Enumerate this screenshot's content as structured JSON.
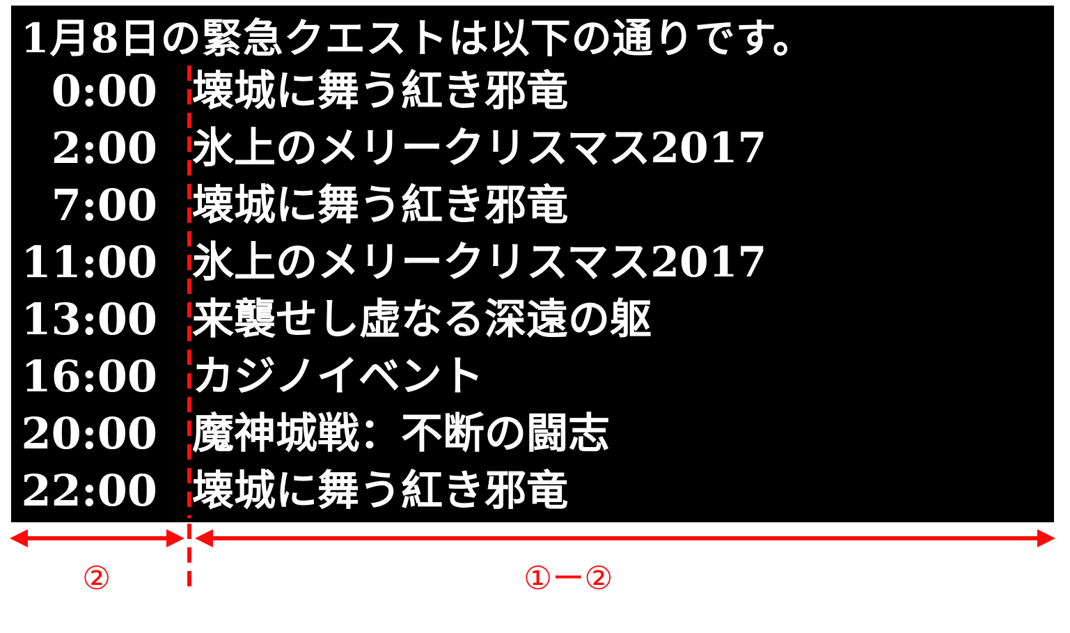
{
  "title": "1月8日の緊急クエストは以下の通りです。",
  "schedule": [
    {
      "time": "0:00",
      "quest": "壊城に舞う紅き邪竜"
    },
    {
      "time": "2:00",
      "quest": "氷上のメリークリスマス2017"
    },
    {
      "time": "7:00",
      "quest": "壊城に舞う紅き邪竜"
    },
    {
      "time": "11:00",
      "quest": "氷上のメリークリスマス2017"
    },
    {
      "time": "13:00",
      "quest": "来襲せし虚なる深遠の躯"
    },
    {
      "time": "16:00",
      "quest": "カジノイベント"
    },
    {
      "time": "20:00",
      "quest": "魔神城戦：不断の闘志"
    },
    {
      "time": "22:00",
      "quest": "壊城に舞う紅き邪竜"
    }
  ],
  "annotations": {
    "left_label": "②",
    "right_label": "①ー②",
    "color": "#ff0a0a"
  }
}
